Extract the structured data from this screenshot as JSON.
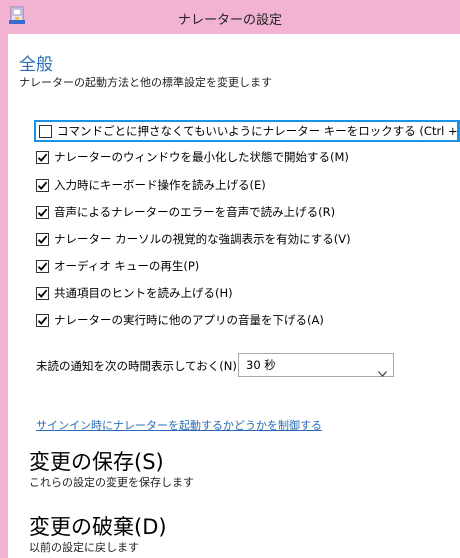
{
  "window": {
    "title": "ナレーターの設定"
  },
  "section": {
    "title": "全般",
    "description": "ナレーターの起動方法と他の標準設定を変更します"
  },
  "options": [
    {
      "label": "コマンドごとに押さなくてもいいようにナレーター キーをロックする (Ctrl + Alt)(L)",
      "checked": false
    },
    {
      "label": "ナレーターのウィンドウを最小化した状態で開始する(M)",
      "checked": true
    },
    {
      "label": "入力時にキーボード操作を読み上げる(E)",
      "checked": true
    },
    {
      "label": "音声によるナレーターのエラーを音声で読み上げる(R)",
      "checked": true
    },
    {
      "label": "ナレーター カーソルの視覚的な強調表示を有効にする(V)",
      "checked": true
    },
    {
      "label": "オーディオ キューの再生(P)",
      "checked": true
    },
    {
      "label": "共通項目のヒントを読み上げる(H)",
      "checked": true
    },
    {
      "label": "ナレーターの実行時に他のアプリの音量を下げる(A)",
      "checked": true
    }
  ],
  "notification": {
    "label": "未読の通知を次の時間表示しておく(N):",
    "selected": "30 秒"
  },
  "link": {
    "text": "サインイン時にナレーターを起動するかどうかを制御する"
  },
  "save": {
    "title": "変更の保存(S)",
    "description": "これらの設定の変更を保存します"
  },
  "discard": {
    "title": "変更の破棄(D)",
    "description": "以前の設定に戻します"
  },
  "colors": {
    "accent": "#2a6bb5",
    "focus": "#1a93e6",
    "frame": "#f2b3d2"
  }
}
